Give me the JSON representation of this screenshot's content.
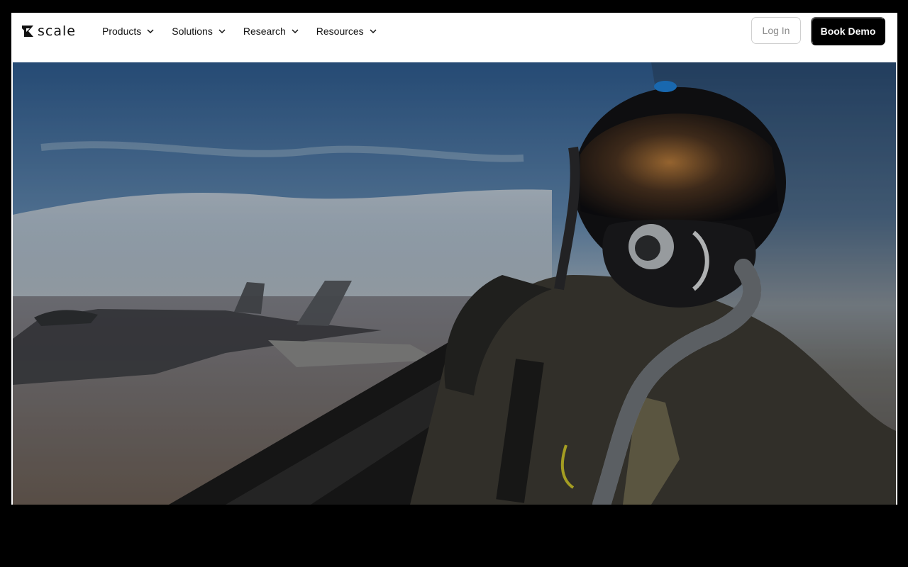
{
  "brand": {
    "name": "scale",
    "logo_icon": "scale-logo-icon"
  },
  "nav": {
    "items": [
      {
        "label": "Products",
        "icon": "chevron-down-icon"
      },
      {
        "label": "Solutions",
        "icon": "chevron-down-icon"
      },
      {
        "label": "Research",
        "icon": "chevron-down-icon"
      },
      {
        "label": "Resources",
        "icon": "chevron-down-icon"
      }
    ]
  },
  "actions": {
    "login_label": "Log In",
    "demo_label": "Book Demo"
  },
  "hero": {
    "media": "hero-video",
    "subject": "pilot-in-cockpit-with-escort-jet"
  },
  "colors": {
    "page_background": "#000000",
    "navbar_background": "#ffffff",
    "primary_button": "#000000",
    "primary_button_text": "#ffffff",
    "secondary_button_border": "#cfcfcf",
    "secondary_button_text": "#8a8a8a"
  }
}
